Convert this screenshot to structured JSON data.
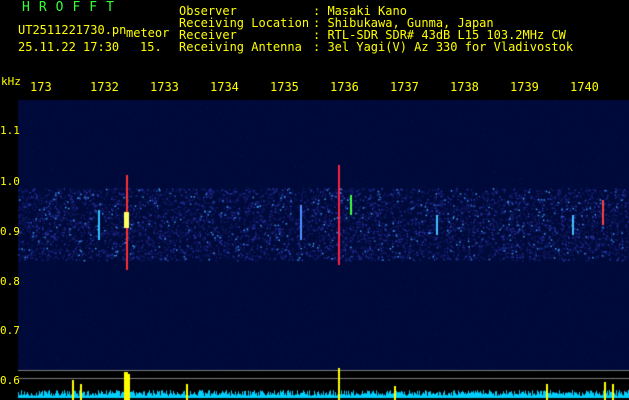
{
  "header": {
    "brand": "HROFFT",
    "filename": "UT2511221730.pn",
    "tag": "meteor",
    "datetime": "25.11.22 17:30",
    "counter": "15.",
    "fields": [
      {
        "label": "Observer",
        "value": ": Masaki Kano"
      },
      {
        "label": "Receiving Location",
        "value": ": Shibukawa, Gunma, Japan"
      },
      {
        "label": "Receiver",
        "value": ": RTL-SDR SDR# 43dB L15 103.2MHz CW"
      },
      {
        "label": "Receiving Antenna",
        "value": ": 3el Yagi(V) Az 330 for Vladivostok"
      }
    ]
  },
  "axis": {
    "unit": "kHz",
    "time_ticks": [
      "173",
      "173",
      "173",
      "173",
      "173",
      "173",
      "173",
      "173",
      "173",
      "1740"
    ],
    "time_tick_suffix": [
      "",
      "2",
      "3",
      "4",
      "5",
      "6",
      "7",
      "8",
      "9",
      ""
    ],
    "freq_ticks": [
      "1.1",
      "1.0",
      "0.9",
      "0.8",
      "0.7",
      "0.6"
    ]
  },
  "colors": {
    "text": "#ffff00",
    "brand": "#33ff33",
    "background": "#000000",
    "noise": "#1a2a8a",
    "echo_hot": "#ff2020",
    "echo_warm": "#ffff40",
    "level_line": "#00d0ff"
  }
}
